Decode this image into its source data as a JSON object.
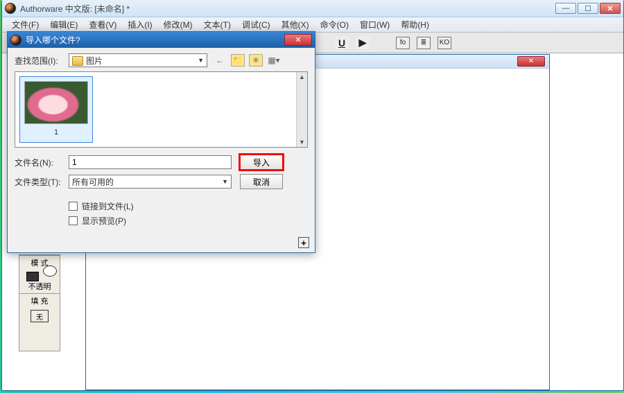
{
  "mainWindow": {
    "title": "Authorware 中文版: [未命名] *",
    "menu": [
      "文件(F)",
      "编辑(E)",
      "查看(V)",
      "插入(I)",
      "修改(M)",
      "文本(T)",
      "调试(C)",
      "其他(X)",
      "命令(O)",
      "窗口(W)",
      "帮助(H)"
    ],
    "toolbar": {
      "underline": "U",
      "play": "▶",
      "fo_icon": "fo",
      "align_icon": "≣",
      "ko_icon": "KO"
    }
  },
  "sidePanel": {
    "sec1": "模 式",
    "mode_val": "不透明",
    "sec2": "填 充",
    "fill_val": "无"
  },
  "dialog": {
    "title": "导入哪个文件?",
    "lookin_label": "查找范围(I):",
    "lookin_value": "图片",
    "thumb_name": "1",
    "filename_label": "文件名(N):",
    "filename_value": "1",
    "filetype_label": "文件类型(T):",
    "filetype_value": "所有可用的",
    "btn_import": "导入",
    "btn_cancel": "取消",
    "chk_link": "链接到文件(L)",
    "chk_preview": "显示预览(P)",
    "expand": "+"
  },
  "winBtns": {
    "min": "—",
    "max": "☐",
    "close": "✕"
  }
}
